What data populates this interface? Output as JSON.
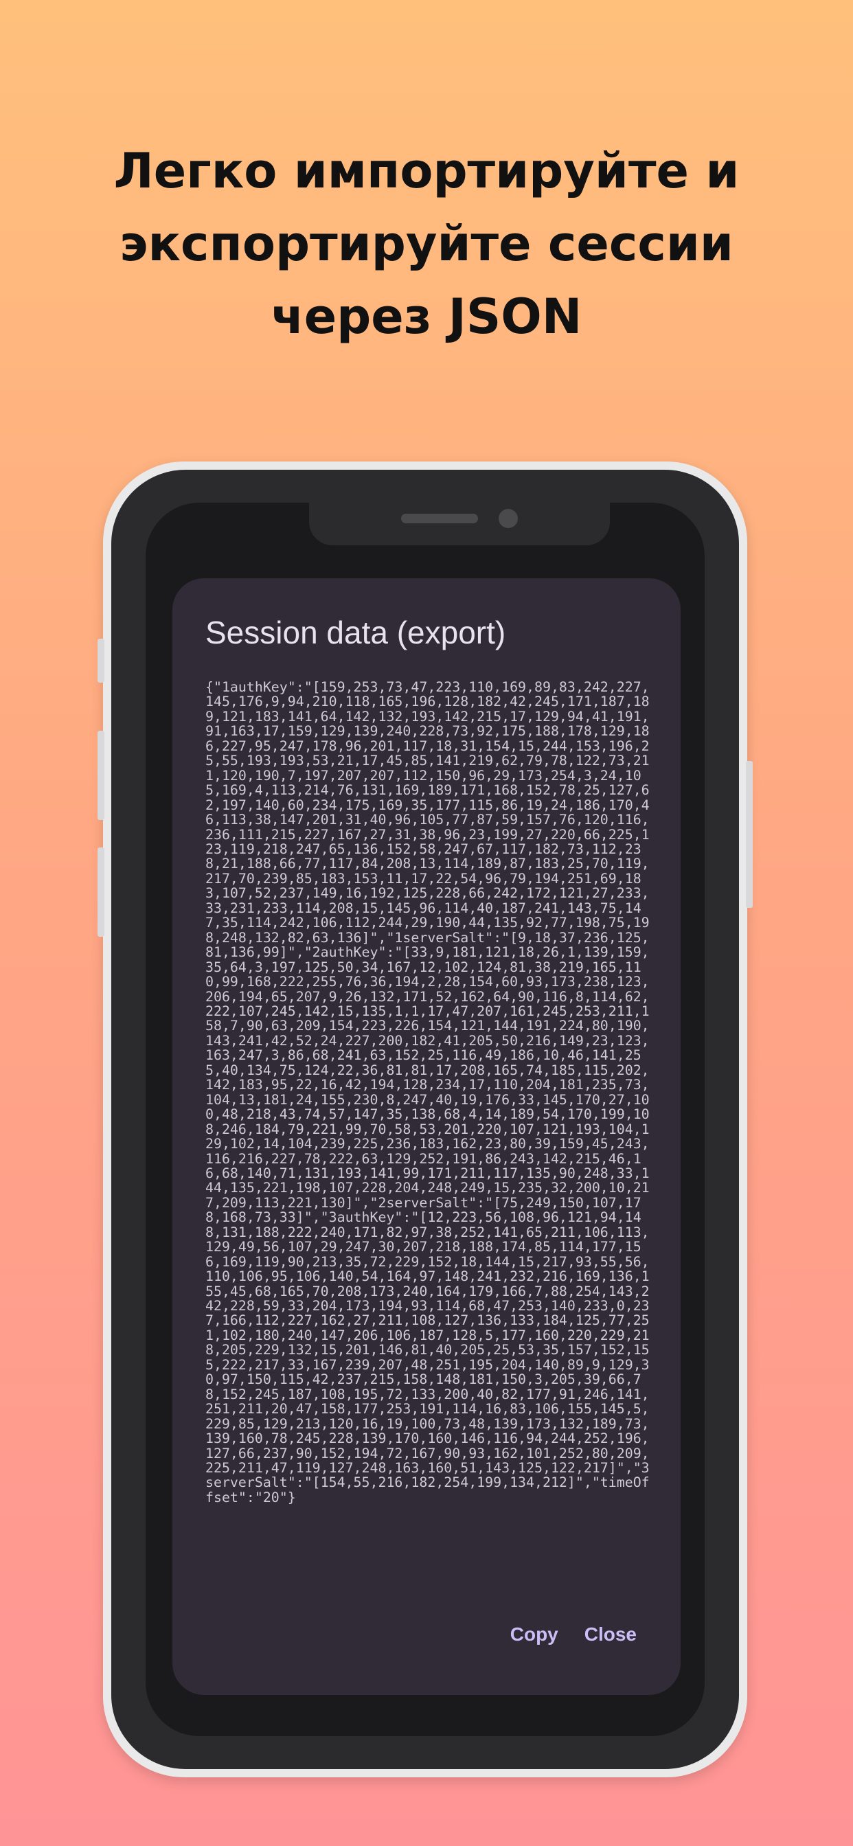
{
  "headline": {
    "line1": "Легко импортируйте и",
    "line2": "экспортируйте сессии",
    "line3": "через JSON"
  },
  "dialog": {
    "title": "Session data (export)",
    "body": "{\"1authKey\":\"[159,253,73,47,223,110,169,89,83,242,227,145,176,9,94,210,118,165,196,128,182,42,245,171,187,189,121,183,141,64,142,132,193,142,215,17,129,94,41,191,91,163,17,159,129,139,240,228,73,92,175,188,178,129,186,227,95,247,178,96,201,117,18,31,154,15,244,153,196,25,55,193,193,53,21,17,45,85,141,219,62,79,78,122,73,211,120,190,7,197,207,207,112,150,96,29,173,254,3,24,105,169,4,113,214,76,131,169,189,171,168,152,78,25,127,62,197,140,60,234,175,169,35,177,115,86,19,24,186,170,46,113,38,147,201,31,40,96,105,77,87,59,157,76,120,116,236,111,215,227,167,27,31,38,96,23,199,27,220,66,225,123,119,218,247,65,136,152,58,247,67,117,182,73,112,238,21,188,66,77,117,84,208,13,114,189,87,183,25,70,119,217,70,239,85,183,153,11,17,22,54,96,79,194,251,69,183,107,52,237,149,16,192,125,228,66,242,172,121,27,233,33,231,233,114,208,15,145,96,114,40,187,241,143,75,147,35,114,242,106,112,244,29,190,44,135,92,77,198,75,198,248,132,82,63,136]\",\"1serverSalt\":\"[9,18,37,236,125,81,136,99]\",\"2authKey\":\"[33,9,181,121,18,26,1,139,159,35,64,3,197,125,50,34,167,12,102,124,81,38,219,165,110,99,168,222,255,76,36,194,2,28,154,60,93,173,238,123,206,194,65,207,9,26,132,171,52,162,64,90,116,8,114,62,222,107,245,142,15,135,1,1,17,47,207,161,245,253,211,158,7,90,63,209,154,223,226,154,121,144,191,224,80,190,143,241,42,52,24,227,200,182,41,205,50,216,149,23,123,163,247,3,86,68,241,63,152,25,116,49,186,10,46,141,255,40,134,75,124,22,36,81,81,17,208,165,74,185,115,202,142,183,95,22,16,42,194,128,234,17,110,204,181,235,73,104,13,181,24,155,230,8,247,40,19,176,33,145,170,27,100,48,218,43,74,57,147,35,138,68,4,14,189,54,170,199,108,246,184,79,221,99,70,58,53,201,220,107,121,193,104,129,102,14,104,239,225,236,183,162,23,80,39,159,45,243,116,216,227,78,222,63,129,252,191,86,243,142,215,46,16,68,140,71,131,193,141,99,171,211,117,135,90,248,33,144,135,221,198,107,228,204,248,249,15,235,32,200,10,217,209,113,221,130]\",\"2serverSalt\":\"[75,249,150,107,178,168,73,33]\",\"3authKey\":\"[12,223,56,108,96,121,94,148,131,188,222,240,171,82,97,38,252,141,65,211,106,113,129,49,56,107,29,247,30,207,218,188,174,85,114,177,156,169,119,90,213,35,72,229,152,18,144,15,217,93,55,56,110,106,95,106,140,54,164,97,148,241,232,216,169,136,155,45,68,165,70,208,173,240,164,179,166,7,88,254,143,242,228,59,33,204,173,194,93,114,68,47,253,140,233,0,237,166,112,227,162,27,211,108,127,136,133,184,125,77,251,102,180,240,147,206,106,187,128,5,177,160,220,229,218,205,229,132,15,201,146,81,40,205,25,53,35,157,152,155,222,217,33,167,239,207,48,251,195,204,140,89,9,129,30,97,150,115,42,237,215,158,148,181,150,3,205,39,66,78,152,245,187,108,195,72,133,200,40,82,177,91,246,141,251,211,20,47,158,177,253,191,114,16,83,106,155,145,5,229,85,129,213,120,16,19,100,73,48,139,173,132,189,73,139,160,78,245,228,139,170,160,146,116,94,244,252,196,127,66,237,90,152,194,72,167,90,93,162,101,252,80,209,225,211,47,119,127,248,163,160,51,143,125,122,217]\",\"3serverSalt\":\"[154,55,216,182,254,199,134,212]\",\"timeOffset\":\"20\"}",
    "actions": {
      "copy": "Copy",
      "close": "Close"
    }
  },
  "colors": {
    "background_top": "#ffc07c",
    "background_bottom": "#ff9496",
    "dialog_bg": "#302b36",
    "accent": "#cdbdf6"
  }
}
